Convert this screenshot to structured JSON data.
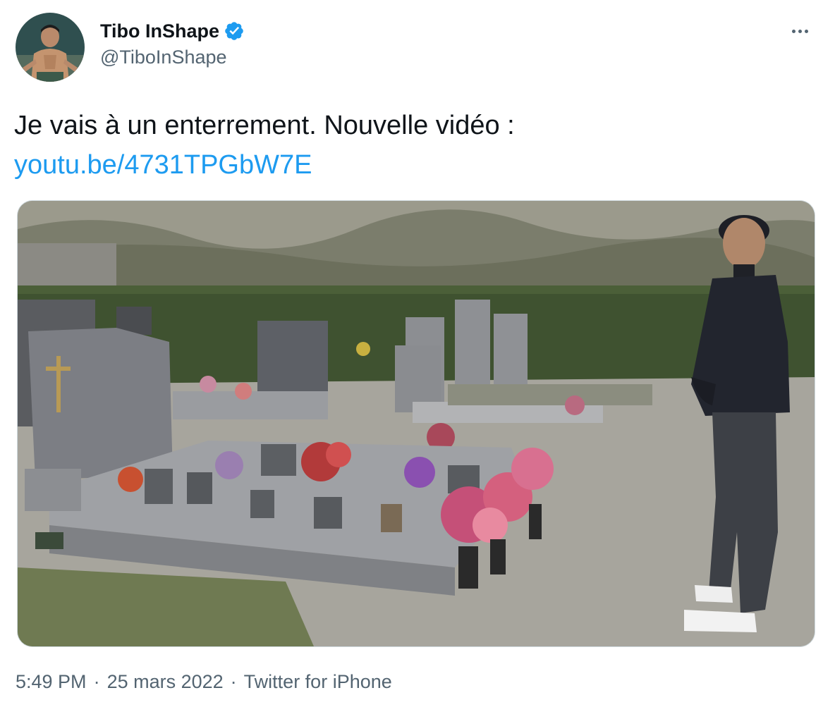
{
  "author": {
    "display_name": "Tibo InShape",
    "handle": "@TiboInShape",
    "verified": true,
    "avatar_icon": "profile-photo"
  },
  "tweet": {
    "text": "Je vais à un enterrement. Nouvelle vidéo :",
    "link": "youtu.be/4731TPGbW7E"
  },
  "meta": {
    "time": "5:49 PM",
    "separator": "·",
    "date": "25 mars 2022",
    "source": "Twitter for iPhone"
  },
  "icons": {
    "more": "more-horizontal-icon",
    "verified": "verified-badge-icon"
  },
  "colors": {
    "link": "#1d9bf0",
    "secondary_text": "#536471",
    "primary_text": "#0f1419",
    "verified": "#1d9bf0"
  }
}
